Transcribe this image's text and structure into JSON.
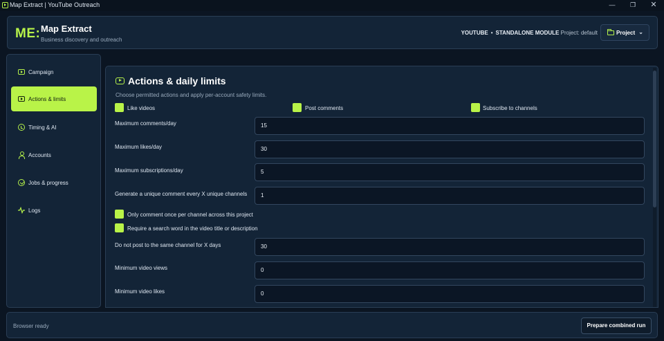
{
  "window": {
    "title": "Map Extract | YouTube Outreach",
    "minimize": "—",
    "maximize": "❐",
    "close": "✕"
  },
  "header": {
    "logo": "ME:",
    "title": "Map Extract",
    "subtitle": "Business discovery and outreach",
    "platform": "YOUTUBE",
    "separator": "•",
    "module": "STANDALONE MODULE",
    "project_info": "Project: default",
    "project_button": "Project"
  },
  "sidebar": {
    "items": [
      {
        "label": "Campaign",
        "icon": "play-icon"
      },
      {
        "label": "Actions & limits",
        "icon": "play-icon",
        "active": true
      },
      {
        "label": "Timing & AI",
        "icon": "clock-icon"
      },
      {
        "label": "Accounts",
        "icon": "user-icon"
      },
      {
        "label": "Jobs & progress",
        "icon": "check-circle-icon"
      },
      {
        "label": "Logs",
        "icon": "activity-icon"
      }
    ]
  },
  "main": {
    "section_title": "Actions & daily limits",
    "section_description": "Choose permitted actions and apply per-account safety limits.",
    "actions": [
      {
        "label": "Like videos",
        "checked": true
      },
      {
        "label": "Post comments",
        "checked": true
      },
      {
        "label": "Subscribe to channels",
        "checked": true
      }
    ],
    "limits": [
      {
        "label": "Maximum comments/day",
        "value": "15"
      },
      {
        "label": "Maximum likes/day",
        "value": "30"
      },
      {
        "label": "Maximum subscriptions/day",
        "value": "5"
      },
      {
        "label": "Generate a unique comment every X unique channels",
        "value": "1"
      }
    ],
    "options": [
      {
        "label": "Only comment once per channel across this project",
        "checked": true
      },
      {
        "label": "Require a search word in the video title or description",
        "checked": true
      }
    ],
    "filters": [
      {
        "label": "Do not post to the same channel for X days",
        "value": "30"
      },
      {
        "label": "Minimum video views",
        "value": "0"
      },
      {
        "label": "Minimum video likes",
        "value": "0"
      }
    ]
  },
  "footer": {
    "status": "Browser ready",
    "prepare_button": "Prepare combined run"
  },
  "colors": {
    "accent": "#b9f348",
    "background": "#0b1522",
    "panel": "#132437",
    "border": "#2a3e55"
  }
}
